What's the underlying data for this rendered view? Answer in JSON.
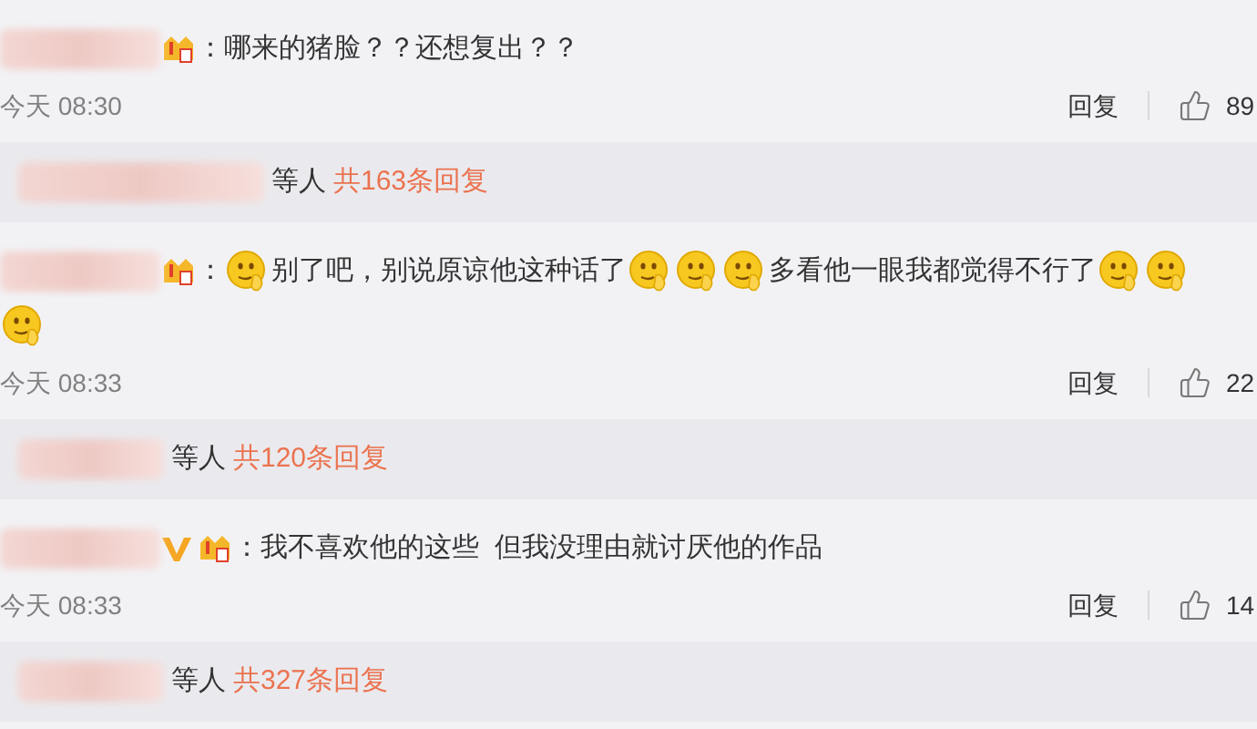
{
  "comments": [
    {
      "badges": [
        {
          "kind": "level"
        }
      ],
      "content": [
        {
          "kind": "text",
          "text": "：哪来的猪脸？？还想复出？？"
        }
      ],
      "time": "今天 08:30",
      "reply_label": "回复",
      "likes": "89",
      "thread": {
        "suffix": "等人",
        "count_link": "共163条回复"
      }
    },
    {
      "badges": [
        {
          "kind": "level"
        }
      ],
      "content": [
        {
          "kind": "text",
          "text": "："
        },
        {
          "kind": "emoji"
        },
        {
          "kind": "text",
          "text": "别了吧，别说原谅他这种话了"
        },
        {
          "kind": "emoji"
        },
        {
          "kind": "emoji"
        },
        {
          "kind": "emoji"
        },
        {
          "kind": "text",
          "text": "多看他一眼我都觉得不行了"
        },
        {
          "kind": "emoji"
        },
        {
          "kind": "emoji"
        },
        {
          "kind": "emoji"
        }
      ],
      "time": "今天 08:33",
      "reply_label": "回复",
      "likes": "22",
      "thread": {
        "suffix": "等人",
        "count_link": "共120条回复"
      }
    },
    {
      "badges": [
        {
          "kind": "verified"
        },
        {
          "kind": "level"
        }
      ],
      "content": [
        {
          "kind": "text",
          "text": "：我不喜欢他的这些  但我没理由就讨厌他的作品"
        }
      ],
      "time": "今天 08:33",
      "reply_label": "回复",
      "likes": "14",
      "thread": {
        "suffix": "等人",
        "count_link": "共327条回复"
      }
    }
  ]
}
